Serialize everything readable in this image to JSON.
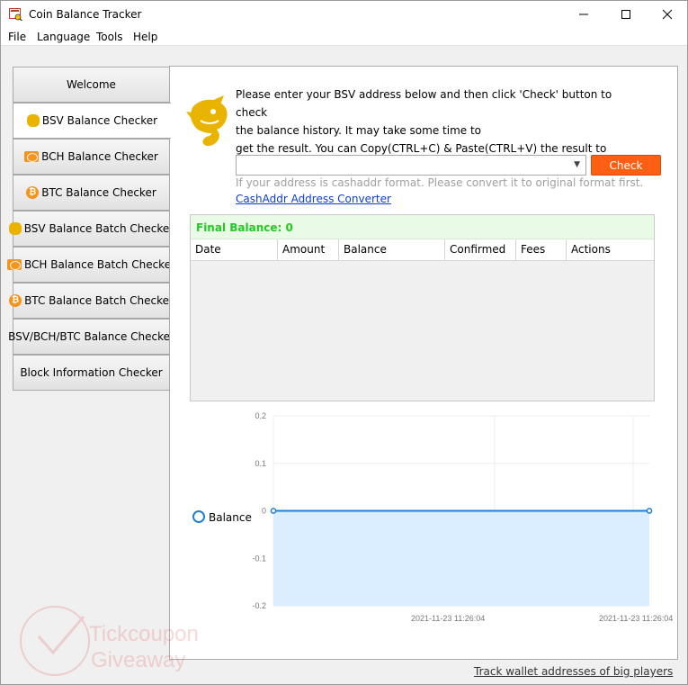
{
  "window": {
    "title": "Coin Balance Tracker"
  },
  "menu": [
    "File",
    "Language",
    "Tools",
    "Help"
  ],
  "sidebar": {
    "items": [
      {
        "label": "Welcome",
        "icon": "none"
      },
      {
        "label": "BSV Balance Checker",
        "icon": "bsv-icon",
        "active": true
      },
      {
        "label": "BCH Balance Checker",
        "icon": "bch-icon"
      },
      {
        "label": "BTC Balance Checker",
        "icon": "btc-icon"
      },
      {
        "label": "BSV Balance Batch Checker",
        "icon": "bsv-icon"
      },
      {
        "label": "BCH Balance Batch Checker",
        "icon": "bch-icon"
      },
      {
        "label": "BTC Balance Batch Checker",
        "icon": "btc-icon"
      },
      {
        "label": "BSV/BCH/BTC Balance Checker",
        "icon": "none"
      },
      {
        "label": "Block Information Checker",
        "icon": "none"
      }
    ]
  },
  "main": {
    "instructions": "Please enter your BSV address below and then click 'Check' button to check the balance history. It may take some time to get the result. You can Copy(CTRL+C) & Paste(CTRL+V) the result to excel file.",
    "instruction_lines": [
      "Please enter your BSV address below and then click 'Check' button to check",
      "the balance history. It may take some time to",
      "get the result. You can Copy(CTRL+C) & Paste(CTRL+V) the result to excel file."
    ],
    "address_value": "",
    "check_label": "Check",
    "hint": "If your address is cashaddr format. Please convert it to original format first.",
    "converter_link": "CashAddr Address Converter",
    "final_balance": "Final Balance: 0",
    "columns": [
      "Date",
      "Amount",
      "Balance",
      "Confirmed",
      "Fees",
      "Actions"
    ]
  },
  "chart_data": {
    "type": "area",
    "series": [
      {
        "name": "Balance",
        "x": [
          "2021-11-23 11:26:04",
          "2021-11-23 11:26:04"
        ],
        "values": [
          0,
          0
        ]
      }
    ],
    "yticks": [
      "0.2",
      "0.1",
      "0",
      "-0.1",
      "-0.2"
    ],
    "xticks": [
      "2021-11-23 11:26:04",
      "2021-11-23 11:26:04"
    ],
    "ylim": [
      -0.2,
      0.2
    ],
    "grid": true,
    "legend_position": "left",
    "line_color": "#1f7fd6",
    "fill_color": "#dbeeff"
  },
  "footer": {
    "link": "Track wallet addresses of big players"
  },
  "watermark": {
    "line1": "Tickcoupon",
    "line2": "Giveaway"
  }
}
